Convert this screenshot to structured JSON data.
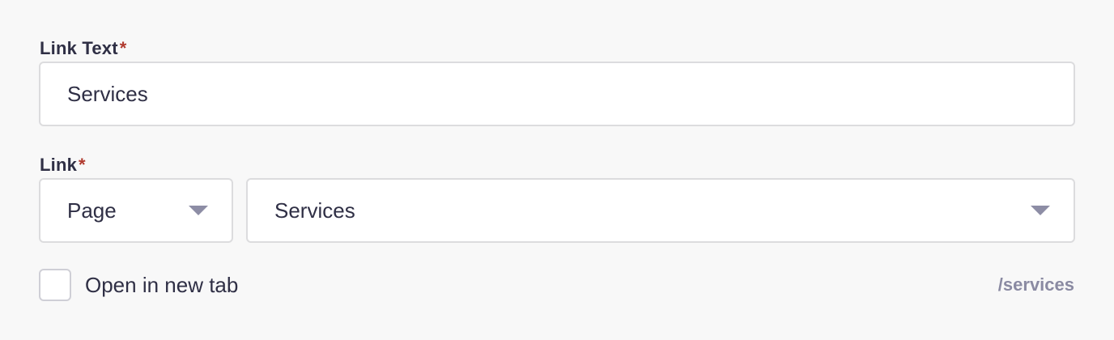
{
  "link_text": {
    "label": "Link Text",
    "required_mark": "*",
    "value": "Services"
  },
  "link": {
    "label": "Link",
    "required_mark": "*",
    "type_select": {
      "value": "Page"
    },
    "target_select": {
      "value": "Services"
    }
  },
  "open_in_new_tab": {
    "label": "Open in new tab",
    "checked": false
  },
  "url_hint": "/services",
  "colors": {
    "required": "#b03a2e",
    "text": "#2f2f45",
    "muted": "#8a8aa2",
    "border": "#dcdcde"
  },
  "icons": {
    "type_select_caret": "chevron-down-icon",
    "target_select_caret": "chevron-down-icon"
  }
}
